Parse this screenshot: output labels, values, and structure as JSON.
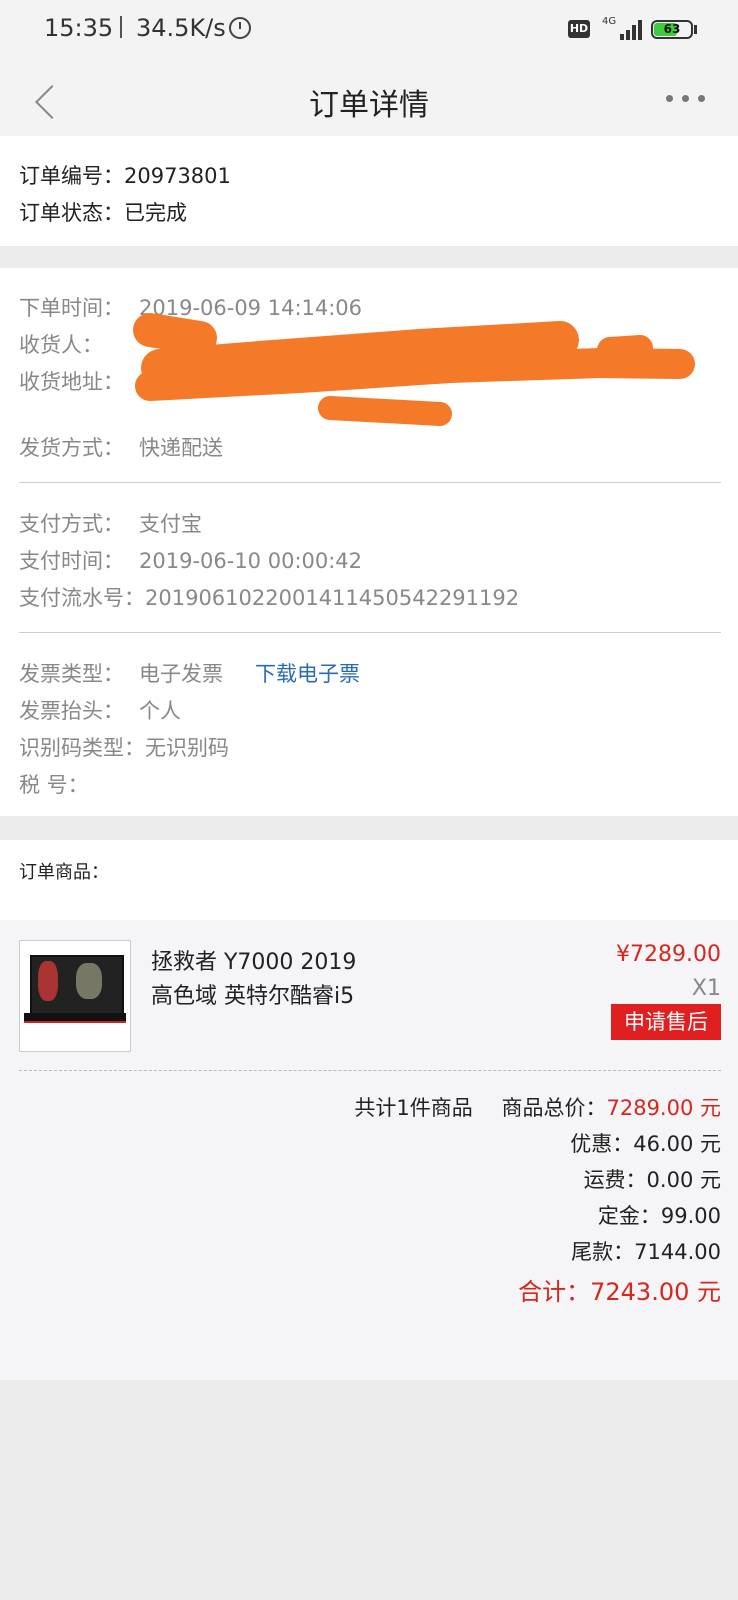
{
  "status_bar": {
    "time": "15:35",
    "net_speed": "34.5K/s",
    "hd_badge": "HD",
    "network_type": "4G",
    "battery_level": "63",
    "battery_percent": 63
  },
  "nav": {
    "title": "订单详情"
  },
  "order": {
    "number_label": "订单编号：",
    "number": "20973801",
    "status_label": "订单状态：",
    "status": "已完成"
  },
  "shipping": {
    "time_label": "下单时间：",
    "time": "2019-06-09 14:14:06",
    "receiver_label": "收货人：",
    "address_label": "收货地址：",
    "delivery_label": "发货方式：",
    "delivery": "快递配送"
  },
  "payment": {
    "method_label": "支付方式：",
    "method": "支付宝",
    "time_label": "支付时间：",
    "time": "2019-06-10 00:00:42",
    "serial_label": "支付流水号：",
    "serial": "2019061022001411450542291192"
  },
  "invoice": {
    "type_label": "发票类型：",
    "type": "电子发票",
    "download_link": "下载电子票",
    "title_label": "发票抬头：",
    "title": "个人",
    "id_type_label": "识别码类型：",
    "id_type": "无识别码",
    "tax_label": "税 号："
  },
  "goods": {
    "header": "订单商品：",
    "product_line1": "拯救者 Y7000 2019",
    "product_line2": "高色域 英特尔酷睿i5",
    "price": "¥7289.00",
    "quantity": "X1",
    "after_sale_button": "申请售后",
    "count_text": "共计1件商品",
    "subtotal_label": "商品总价：",
    "subtotal": "7289.00 元",
    "discount": "优惠：46.00 元",
    "shipping_fee": "运费：0.00 元",
    "deposit": "定金：99.00",
    "balance": "尾款：7144.00",
    "total": "合计：7243.00 元"
  },
  "colors": {
    "accent_red": "#d9261c",
    "link_blue": "#2a6bb5",
    "redaction_orange": "#f47a2a"
  }
}
